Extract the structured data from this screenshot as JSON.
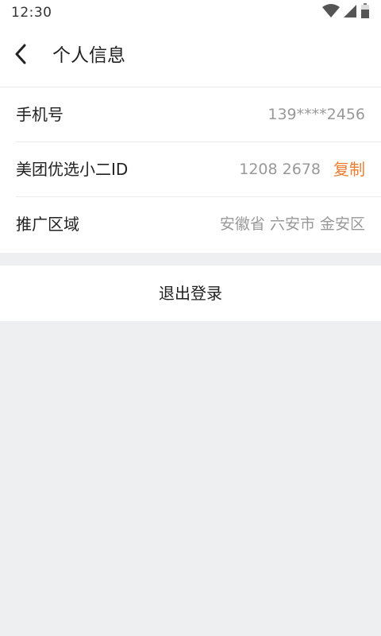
{
  "status_bar": {
    "time": "12:30",
    "icons": [
      "wifi-icon",
      "signal-icon",
      "battery-icon"
    ]
  },
  "nav": {
    "back_icon": "chevron-left-icon",
    "title": "个人信息"
  },
  "info": {
    "rows": [
      {
        "label": "手机号",
        "value": "139****2456"
      },
      {
        "label": "美团优选小二ID",
        "value": "1208 2678",
        "action": "复制"
      },
      {
        "label": "推广区域",
        "value": "安徽省 六安市 金安区"
      }
    ]
  },
  "logout": {
    "label": "退出登录"
  },
  "colors": {
    "accent": "#ed7d31",
    "background": "#eeeff1",
    "secondary_text": "#999999"
  }
}
